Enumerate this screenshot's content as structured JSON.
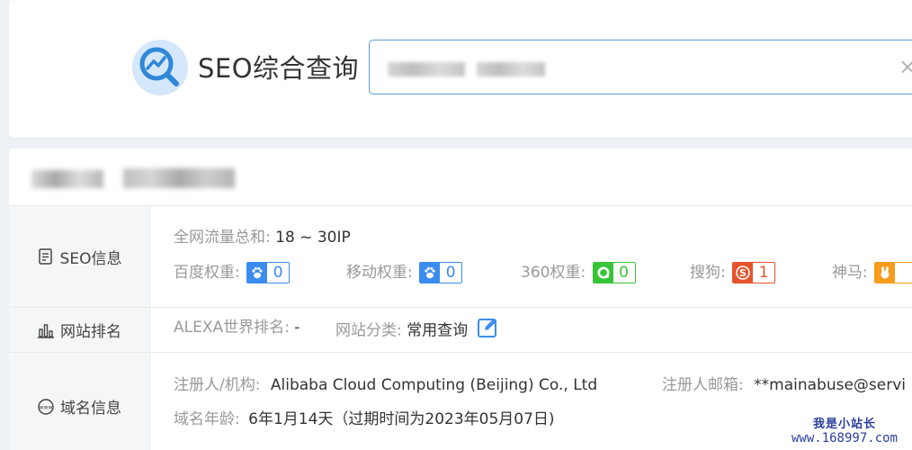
{
  "header": {
    "title": "SEO综合查询",
    "search_clear_icon": "×",
    "logo_icon": "seo-chart-search-icon"
  },
  "rows": {
    "seo": {
      "label": "SEO信息",
      "icon": "document-icon",
      "traffic": {
        "key": "全网流量总和:",
        "value": "18 ~ 30IP"
      },
      "weights": [
        {
          "key": "百度权重:",
          "value": "0",
          "icon": "baidu-paw-icon"
        },
        {
          "key": "移动权重:",
          "value": "0",
          "icon": "baidu-paw-icon"
        },
        {
          "key": "360权重:",
          "value": "0",
          "icon": "360-icon"
        },
        {
          "key": "搜狗:",
          "value": "1",
          "icon": "sogou-icon"
        },
        {
          "key": "神马:",
          "value": "",
          "icon": "shenma-icon"
        }
      ]
    },
    "rank": {
      "label": "网站排名",
      "icon": "bar-chart-icon",
      "alexa": {
        "key": "ALEXA世界排名:",
        "value": "-"
      },
      "category": {
        "key": "网站分类:",
        "value": "常用查询"
      }
    },
    "domain": {
      "label": "域名信息",
      "icon": "www-icon",
      "registrant": {
        "key": "注册人/机构:",
        "value": "Alibaba Cloud Computing (Beijing) Co., Ltd"
      },
      "email": {
        "key": "注册人邮箱:",
        "value": "**mainabuse@servi"
      },
      "age": {
        "key": "域名年龄:",
        "value": "6年1月14天（过期时间为2023年05月07日)"
      }
    }
  },
  "watermark": {
    "line1": "我是小站长",
    "line2": "www.168997.com"
  },
  "colors": {
    "baidu": "#3b8cf0",
    "qihoo360": "#37c537",
    "sogou": "#e5532a",
    "shenma": "#f89c1c",
    "accent": "#5b9bd5"
  }
}
